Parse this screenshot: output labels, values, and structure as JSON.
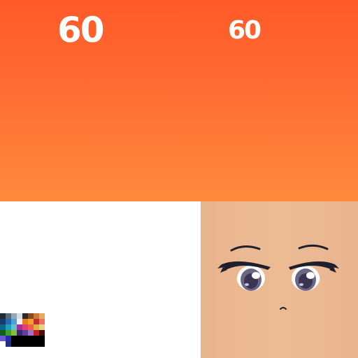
{
  "texture": {
    "label_large": "60",
    "label_small": "60"
  },
  "colors": {
    "orange_top": "#ff5a28",
    "orange_bottom": "#ff8a3c",
    "skin": "#e8b48e",
    "eye_iris": "#6b6684",
    "eyeliner": "#1f1f2b"
  },
  "palette": [
    [
      "#1e2a35",
      "#5a6a78",
      "#9aa6b0",
      "#d8dde2",
      "#2a2a2a",
      "#8a4a20",
      "#c87a3a",
      "#e8a860"
    ],
    [
      "#1a3a6a",
      "#2a6ab0",
      "#4aa0e0",
      "#f0f0f0",
      "#e87a20",
      "#f0a030",
      "#c03030",
      "#f07060"
    ],
    [
      "#0a6a8a",
      "#20a0c0",
      "#60c0d0",
      "#a030a0",
      "#e04080",
      "#f06040",
      "#e0b040",
      "#f0d080"
    ],
    [
      "#106020",
      "#40a030",
      "#80c040",
      "#3a2a6a",
      "#6040a0",
      "#a070d0",
      "#c02020",
      "#4a1010"
    ],
    [
      "#6a5ad0",
      "#2a2ab0",
      "#000000",
      "#000000",
      "#000000",
      "#000000",
      "#000000",
      "#000000"
    ],
    [
      "#ffffff",
      "#203080",
      "#000000",
      "#000000",
      "#000000",
      "#000000",
      "#000000",
      "#000000"
    ]
  ]
}
